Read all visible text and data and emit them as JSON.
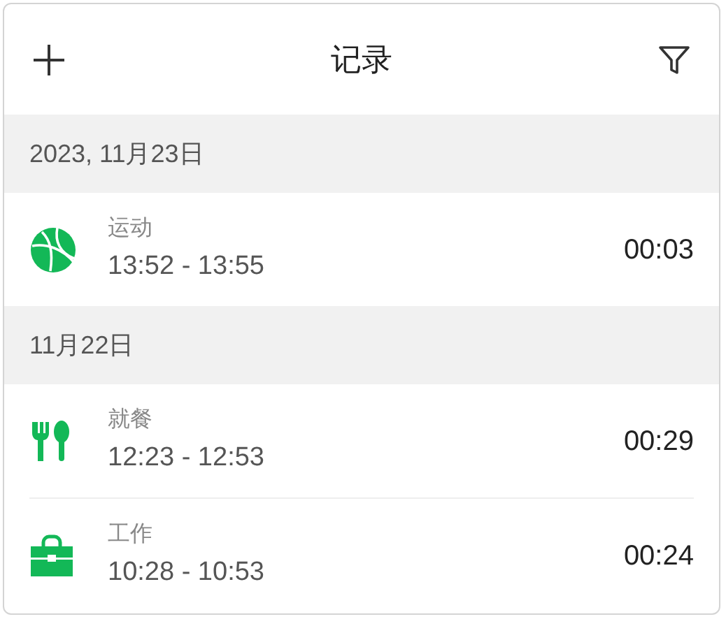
{
  "header": {
    "title": "记录"
  },
  "groups": [
    {
      "date": "2023, 11月23日",
      "entries": [
        {
          "kind": "ball",
          "activity": "运动",
          "time_range": "13:52 - 13:55",
          "duration": "00:03"
        }
      ]
    },
    {
      "date": "11月22日",
      "entries": [
        {
          "kind": "meal",
          "activity": "就餐",
          "time_range": "12:23 - 12:53",
          "duration": "00:29"
        },
        {
          "kind": "work",
          "activity": "工作",
          "time_range": "10:28 - 10:53",
          "duration": "00:24"
        }
      ]
    }
  ]
}
